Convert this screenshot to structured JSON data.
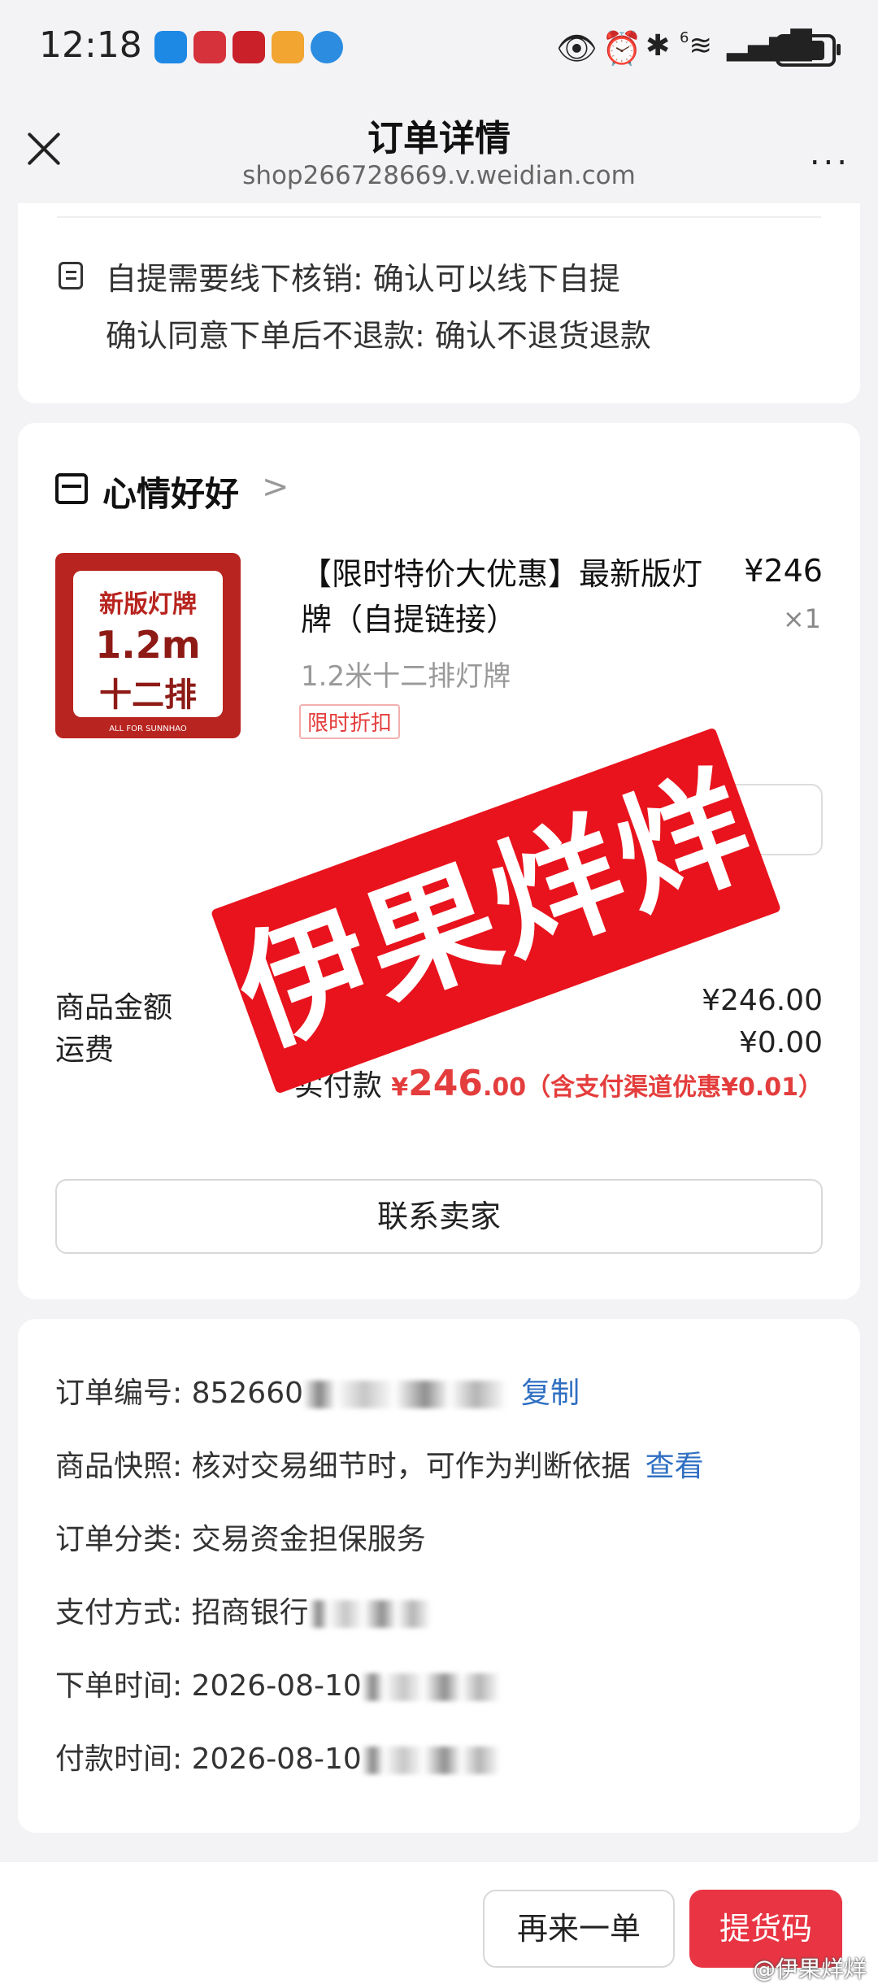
{
  "status_bar": {
    "time": "12:18",
    "notification_icons": [
      "messages-icon",
      "huawei-icon",
      "shop-app-icon",
      "food-app-icon",
      "browser-icon"
    ],
    "system_icons": [
      "eye-icon",
      "alarm-icon",
      "bluetooth-icon",
      "wifi-icon",
      "signal-icon",
      "battery-icon"
    ],
    "wifi_label": "6"
  },
  "nav": {
    "title": "订单详情",
    "url": "shop266728669.v.weidian.com",
    "more": "..."
  },
  "notes": {
    "line1": "自提需要线下核销: 确认可以线下自提",
    "line2": "确认同意下单后不退款: 确认不退货退款"
  },
  "shop": {
    "name": "心情好好",
    "chevron": ">"
  },
  "product": {
    "image_line1": "新版灯牌",
    "image_line2": "1.2m",
    "image_line3": "十二排",
    "image_footer": "ALL FOR SUNNHAO",
    "title": "【限时特价大优惠】最新版灯牌（自提链接）",
    "price": "¥246",
    "qty": "×1",
    "spec": "1.2米十二排灯牌",
    "tag": "限时折扣"
  },
  "summary": {
    "goods_label": "商品金额",
    "goods_value": "¥246.00",
    "shipping_label": "运费",
    "shipping_value": "¥0.00",
    "paid_label": "实付款",
    "paid_currency": "¥",
    "paid_amount": "246",
    "paid_decimals": ".00",
    "paid_note": "（含支付渠道优惠¥0.01）"
  },
  "contact_button": "联系卖家",
  "order_info": {
    "order_no_label": "订单编号: 852660",
    "copy_link": "复制",
    "snapshot_label": "商品快照: 核对交易细节时，可作为判断依据",
    "view_link": "查看",
    "category_label": "订单分类: 交易资金担保服务",
    "payment_label": "支付方式: 招商银行",
    "order_time_label": "下单时间: 2026-08-10",
    "paid_time_label": "付款时间: 2026-08-10"
  },
  "watermark_text": "伊果烊烊",
  "bottom": {
    "again_button": "再来一单",
    "pickup_button": "提货码",
    "weibo_mark": "@伊果烊烊"
  },
  "colors": {
    "accent_red": "#e93543",
    "price_red": "#e43d3d",
    "link_blue": "#2f6fc2",
    "page_bg": "#f3f3f5"
  }
}
